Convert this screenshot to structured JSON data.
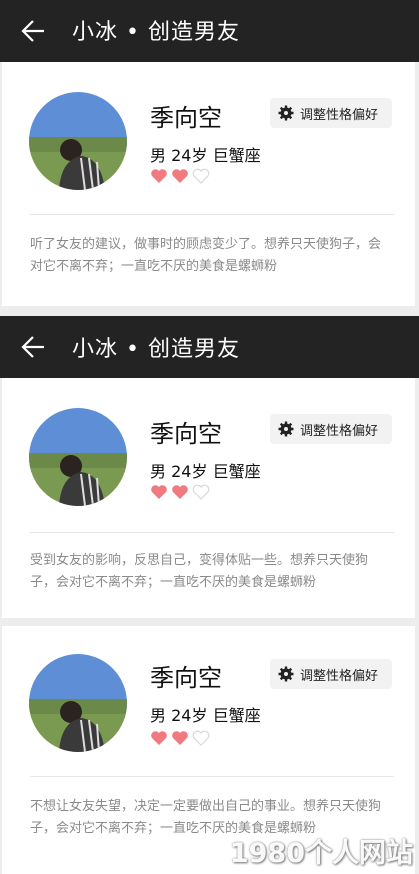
{
  "header_title": "小冰 • 创造男友",
  "profile": {
    "name": "季向空",
    "gender": "男",
    "age": "24岁",
    "zodiac": "巨蟹座",
    "adjust_button": "调整性格偏好",
    "hearts_filled": 2,
    "hearts_total": 3
  },
  "cards": [
    {
      "description": "听了女友的建议，做事时的顾虑变少了。想养只天使狗子，会对它不离不弃；一直吃不厌的美食是螺蛳粉"
    },
    {
      "description": "受到女友的影响，反思自己，变得体贴一些。想养只天使狗子，会对它不离不弃；一直吃不厌的美食是螺蛳粉"
    },
    {
      "description": "不想让女友失望，决定一定要做出自己的事业。想养只天使狗子，会对它不离不弃；一直吃不厌的美食是螺蛳粉"
    }
  ],
  "watermark": "1980个人网站",
  "colors": {
    "topbar": "#232323",
    "heart": "#f07a80",
    "desc": "#8a8a8a"
  }
}
